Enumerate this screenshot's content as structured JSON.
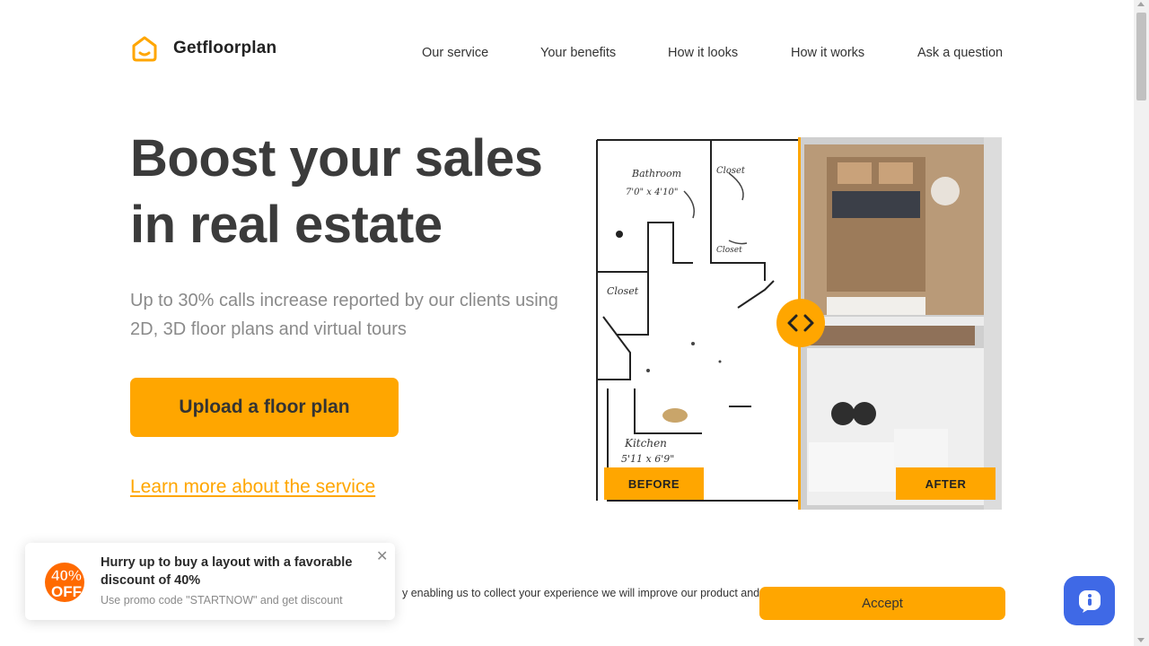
{
  "brand": {
    "name": "Getfloorplan",
    "logo_icon": "house-icon",
    "accent": "#ffa600"
  },
  "nav": {
    "items": [
      {
        "label": "Our service"
      },
      {
        "label": "Your benefits"
      },
      {
        "label": "How it looks"
      },
      {
        "label": "How it works"
      },
      {
        "label": "Ask a question"
      }
    ]
  },
  "hero": {
    "title_line1": "Boost your sales",
    "title_line2": "in real estate",
    "subtitle": "Up to 30% calls increase reported by our clients using 2D, 3D floor plans and virtual tours",
    "cta_label": "Upload a floor plan",
    "learn_more_label": "Learn more about the service"
  },
  "compare": {
    "before_label": "BEFORE",
    "after_label": "AFTER",
    "handle_icon": "chevron-left-right-icon",
    "sketch_labels": [
      "Bathroom",
      "7'0\" x 4'10\"",
      "Closet",
      "Closet",
      "Closet",
      "Kitchen",
      "5'11 x 6'9\""
    ]
  },
  "promo": {
    "badge_text_top": "40%",
    "badge_text_bottom": "OFF",
    "title": "Hurry up to buy a layout with a favorable discount of 40%",
    "code_text": "Use promo code \"STARTNOW\" and get discount",
    "close_icon": "close-icon"
  },
  "cookie": {
    "text": "y enabling us to collect your experience we will improve our product and",
    "accept_label": "Accept"
  },
  "chat": {
    "icon": "chat-icon",
    "color": "#3f69e6"
  }
}
